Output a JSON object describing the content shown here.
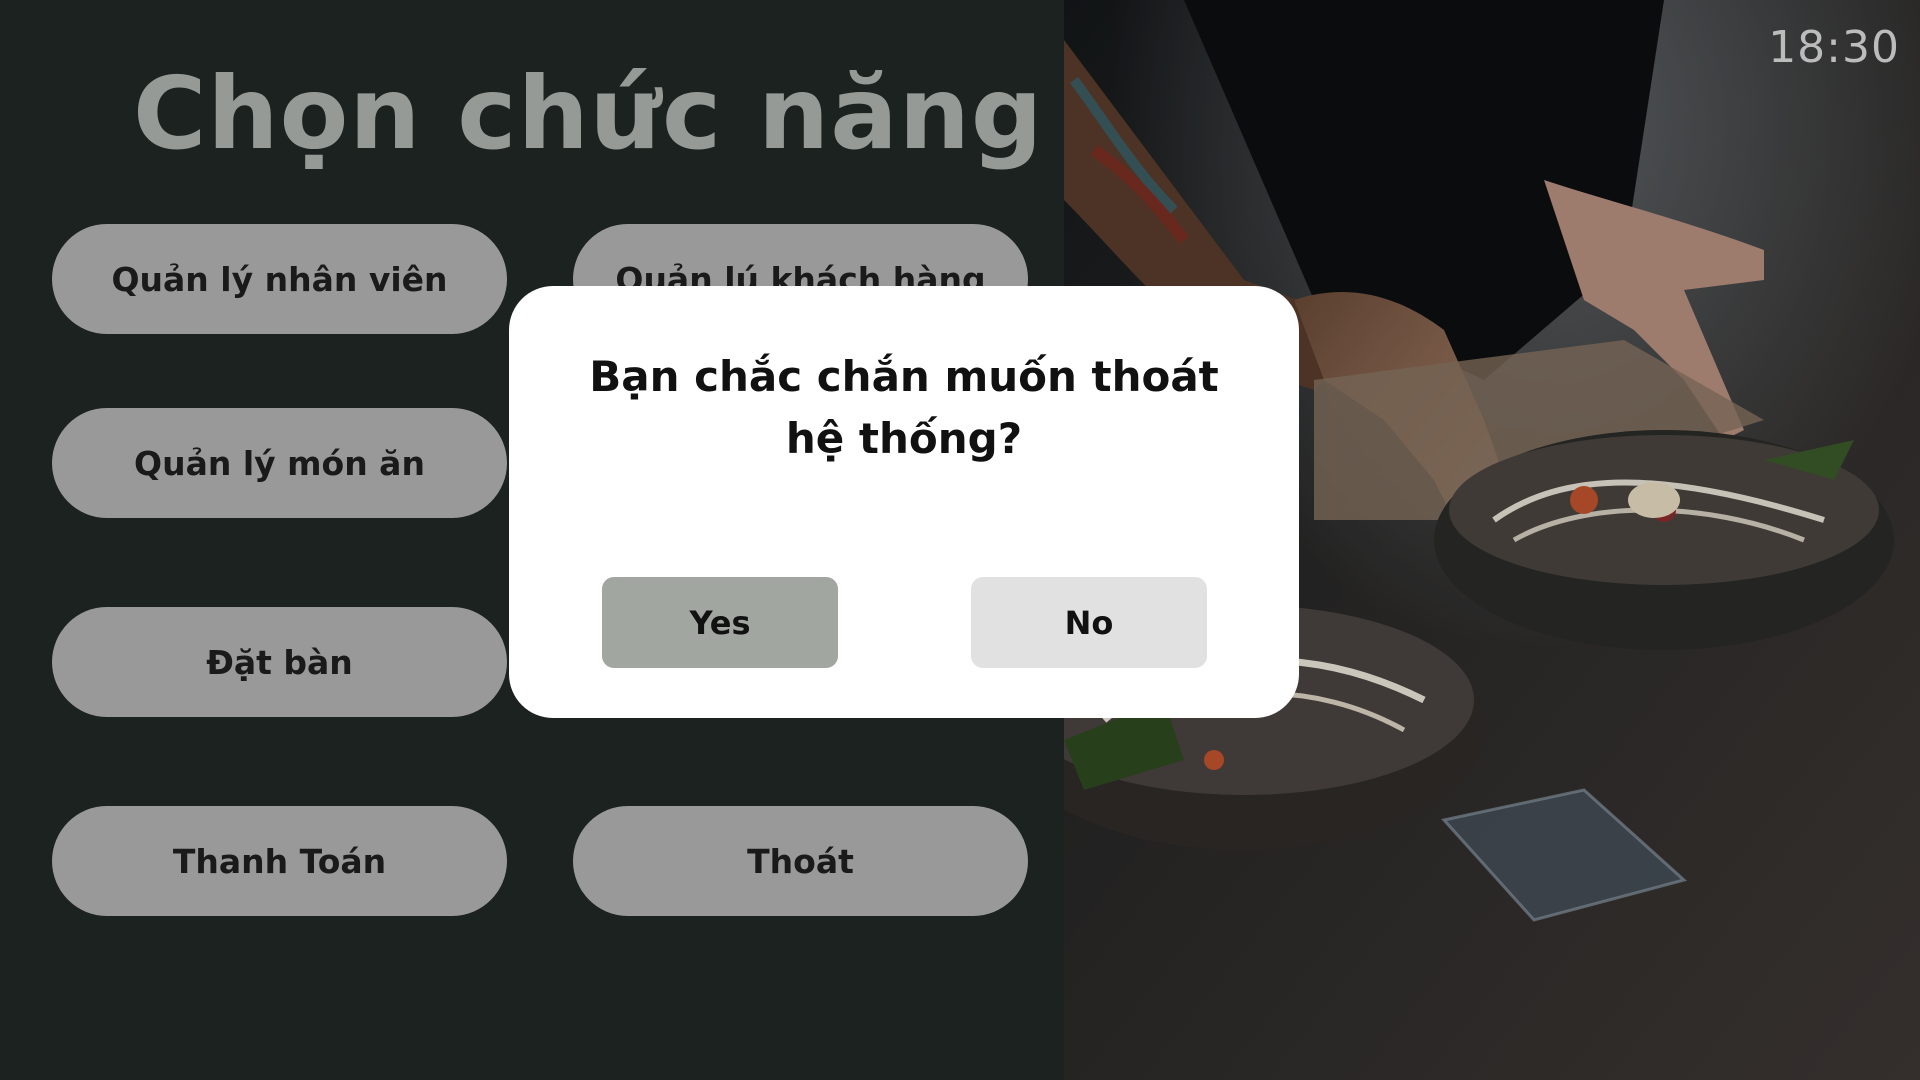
{
  "page_title": "Chọn chức năng",
  "clock": "18:30",
  "menu": {
    "staff_label": "Quản lý nhân viên",
    "customer_label": "Quản lú khách hàng",
    "dish_label": "Quản lý món ăn",
    "booking_label": "Đặt bàn",
    "payment_label": "Thanh Toán",
    "exit_label": "Thoát"
  },
  "dialog": {
    "message_line1": "Bạn chắc chắn muốn thoát",
    "message_line2": "hệ thống?",
    "yes_label": "Yes",
    "no_label": "No"
  },
  "colors": {
    "background": "#1c2220",
    "title": "#959a97",
    "pill": "#999999",
    "dialog": "#ffffff",
    "yes_button": "#a1a6a0",
    "no_button": "#e1e1e1"
  },
  "image": {
    "subject": "chef-plating-noodle-bowls-photo"
  }
}
